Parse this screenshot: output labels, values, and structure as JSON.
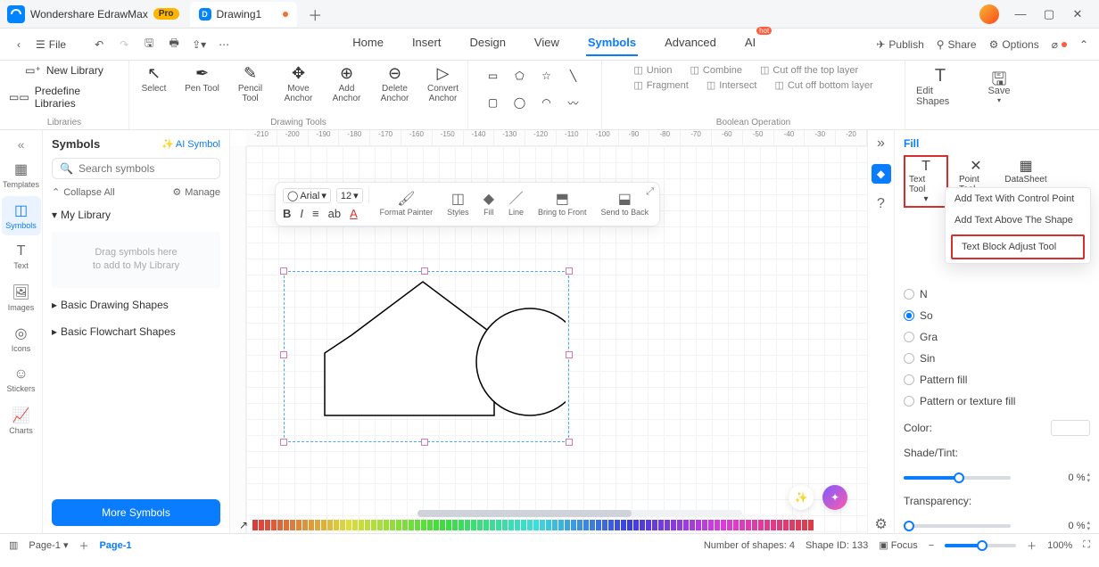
{
  "titlebar": {
    "app": "Wondershare EdrawMax",
    "pro": "Pro",
    "tab": "Drawing1"
  },
  "menubar": {
    "file": "File",
    "items": [
      "Home",
      "Insert",
      "Design",
      "View",
      "Symbols",
      "Advanced",
      "AI"
    ],
    "active": "Symbols",
    "publish": "Publish",
    "share": "Share",
    "options": "Options"
  },
  "ribbon": {
    "lib": {
      "new": "New Library",
      "predef": "Predefine Libraries",
      "label": "Libraries"
    },
    "draw": {
      "select": "Select",
      "pen": "Pen Tool",
      "pencil": "Pencil Tool",
      "move": "Move Anchor",
      "add": "Add Anchor",
      "delete": "Delete Anchor",
      "convert": "Convert Anchor",
      "label": "Drawing Tools"
    },
    "bool": {
      "union": "Union",
      "combine": "Combine",
      "cuttop": "Cut off the top layer",
      "fragment": "Fragment",
      "intersect": "Intersect",
      "cutbot": "Cut off bottom layer",
      "label": "Boolean Operation"
    },
    "edit": "Edit Shapes",
    "save": "Save"
  },
  "leftrail": [
    "Templates",
    "Symbols",
    "Text",
    "Images",
    "Icons",
    "Stickers",
    "Charts"
  ],
  "symbolsPanel": {
    "title": "Symbols",
    "ai": "AI Symbol",
    "searchPlaceholder": "Search symbols",
    "collapse": "Collapse All",
    "manage": "Manage",
    "mylib": "My Library",
    "drop1": "Drag symbols here",
    "drop2": "to add to My Library",
    "cat1": "Basic Drawing Shapes",
    "cat2": "Basic Flowchart Shapes",
    "more": "More Symbols"
  },
  "ruler": [
    "-210",
    "-200",
    "-190",
    "-180",
    "-170",
    "-160",
    "-150",
    "-140",
    "-130",
    "-120",
    "-110",
    "-100",
    "-90",
    "-80",
    "-70",
    "-60",
    "-50",
    "-40",
    "-30",
    "-20"
  ],
  "floatbar": {
    "font": "Arial",
    "size": "12",
    "format": "Format Painter",
    "styles": "Styles",
    "fill": "Fill",
    "line": "Line",
    "front": "Bring to Front",
    "back": "Send to Back"
  },
  "props": {
    "fillTab": "Fill",
    "texttool": "Text Tool",
    "pointtool": "Point Tool",
    "datasheet": "DataSheet",
    "dd1": "Add Text With Control Point",
    "dd2": "Add Text Above The Shape",
    "dd3": "Text Block Adjust Tool",
    "r_n": "N",
    "r_so": "So",
    "r_gra": "Gra",
    "r_sin": "Sin",
    "r_pattern": "Pattern fill",
    "r_tex": "Pattern or texture fill",
    "color": "Color:",
    "shade": "Shade/Tint:",
    "trans": "Transparency:",
    "pct": "0 %"
  },
  "status": {
    "page": "Page-1",
    "sheet": "Page-1",
    "shapes": "Number of shapes: 4",
    "shapeid": "Shape ID: 133",
    "focus": "Focus",
    "zoom": "100%"
  }
}
